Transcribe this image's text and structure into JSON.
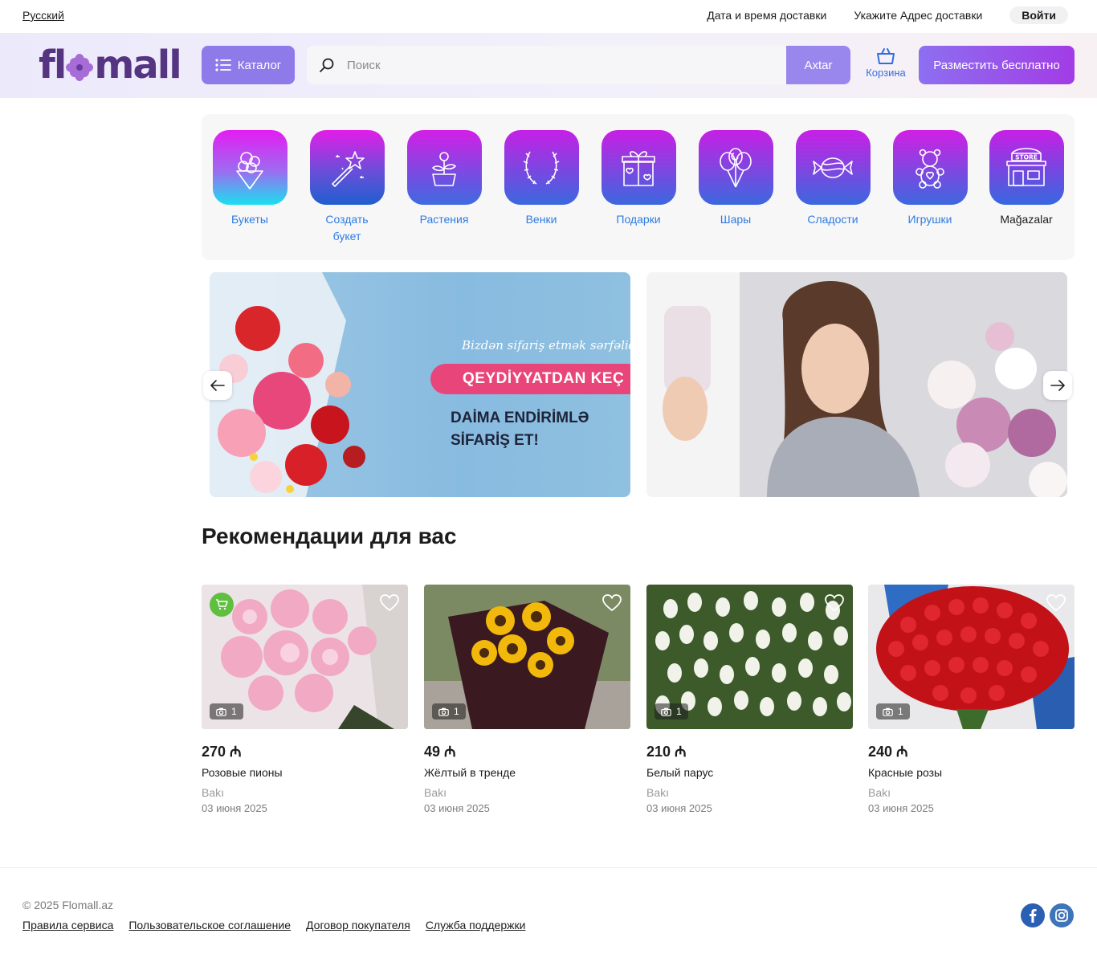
{
  "topbar": {
    "language": "Русский",
    "delivery_time": "Дата и время доставки",
    "delivery_address": "Укажите Адрес доставки",
    "login": "Войти"
  },
  "header": {
    "logo_left": "fl",
    "logo_right": "mall",
    "catalog": "Каталог",
    "search_placeholder": "Поиск",
    "search_button": "Axtar",
    "cart": "Корзина",
    "post_free": "Разместить бесплатно"
  },
  "categories": [
    {
      "label": "Букеты",
      "icon": "bouquet-icon"
    },
    {
      "label": "Создать букет",
      "icon": "magic-wand-icon"
    },
    {
      "label": "Растения",
      "icon": "potted-plant-icon"
    },
    {
      "label": "Венки",
      "icon": "wreath-icon"
    },
    {
      "label": "Подарки",
      "icon": "gift-icon"
    },
    {
      "label": "Шары",
      "icon": "balloons-icon"
    },
    {
      "label": "Сладости",
      "icon": "candy-icon"
    },
    {
      "label": "Игрушки",
      "icon": "teddy-bear-icon"
    },
    {
      "label": "Mağazalar",
      "icon": "store-icon",
      "store_sign": "STORE"
    }
  ],
  "banner": {
    "tagline": "Bizdən sifariş etmək sərfəlidir",
    "cta": "QEYDİYYATDAN KEÇ",
    "text": "DAİMA ENDİRİMLƏ\nSİFARİŞ ET!"
  },
  "recommendations": {
    "title": "Рекомендации для вас",
    "items": [
      {
        "price": "270 ₼",
        "name": "Розовые пионы",
        "city": "Bakı",
        "date": "03 июня 2025",
        "photos": "1",
        "in_cart": true
      },
      {
        "price": "49 ₼",
        "name": "Жёлтый в тренде",
        "city": "Bakı",
        "date": "03 июня 2025",
        "photos": "1",
        "in_cart": false
      },
      {
        "price": "210 ₼",
        "name": "Белый парус",
        "city": "Bakı",
        "date": "03 июня 2025",
        "photos": "1",
        "in_cart": false
      },
      {
        "price": "240 ₼",
        "name": "Красные розы",
        "city": "Bakı",
        "date": "03 июня 2025",
        "photos": "1",
        "in_cart": false
      }
    ]
  },
  "footer": {
    "copyright": "© 2025 Flomall.az",
    "links": [
      "Правила сервиса",
      "Пользовательское соглашение",
      "Договор покупателя",
      "Служба поддержки"
    ]
  },
  "colors": {
    "brand": "#553582",
    "accent": "#8e7ae8",
    "link": "#2f7be0"
  }
}
